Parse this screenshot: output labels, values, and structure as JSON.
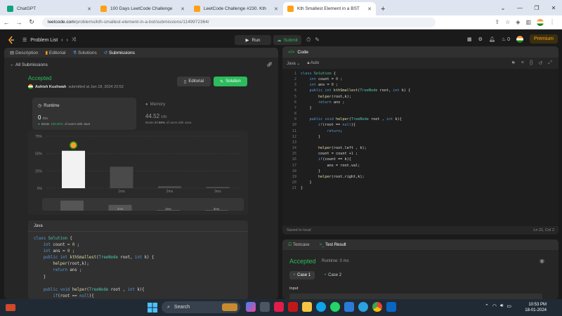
{
  "browser": {
    "tabs": [
      {
        "title": "ChatGPT",
        "color": "#10a37f"
      },
      {
        "title": "100 Days LeetCode Challenge",
        "color": "#ffa116"
      },
      {
        "title": "LeetCode Challenge #230. Kth",
        "color": "#ffa116"
      },
      {
        "title": "Kth Smallest Element in a BST",
        "color": "#ffa116"
      }
    ],
    "url_host": "leetcode.com",
    "url_path": "/problems/kth-smallest-element-in-a-bst/submissions/1149972364/"
  },
  "lc_header": {
    "problem_list": "Problem List",
    "run": "Run",
    "submit": "Submit",
    "streak": "0",
    "premium": "Premium"
  },
  "left_panel": {
    "tabs": [
      "Description",
      "Editorial",
      "Solutions",
      "Submissions"
    ],
    "all_submissions": "All Submissions",
    "status": "Accepted",
    "author": "Ashish Kushwah",
    "submitted": "submitted at Jan 18, 2024 22:52",
    "editorial_btn": "Editorial",
    "solution_btn": "Solution",
    "runtime": {
      "label": "Runtime",
      "value": "0",
      "unit": "ms",
      "beats_prefix": "Beats",
      "beats": "100.00%",
      "beats_suffix": "of users with Java"
    },
    "memory": {
      "label": "Memory",
      "value": "44.52",
      "unit": "MB",
      "beats_prefix": "Beats",
      "beats": "27.66%",
      "beats_suffix": "of users with Java"
    },
    "code_lang": "Java"
  },
  "chart_data": {
    "type": "bar",
    "yticks": [
      "75%",
      "50%",
      "25%",
      "0%"
    ],
    "ylim": [
      0,
      75
    ],
    "categories": [
      "",
      "1ms",
      "2ms",
      "3ms"
    ],
    "values": [
      54,
      31,
      3,
      2
    ],
    "highlight_index": 0,
    "overview_labels": [
      "",
      "1ms",
      "2ms",
      "3ms"
    ]
  },
  "submitted_code": [
    "class Solution {",
    "    int count = 0 ;",
    "    int ans = 0 ;",
    "    public int kthSmallest(TreeNode root, int k) {",
    "        helper(root,k);",
    "        return ans ;",
    "    }",
    "",
    "    public void helper(TreeNode root , int k){",
    "        if(root == null){"
  ],
  "editor": {
    "title": "Code",
    "lang": "Java",
    "mode": "Auto",
    "lines": [
      "class Solution {",
      "    int count = 0 ;",
      "    int ans = 0 ;",
      "    public int kthSmallest(TreeNode root, int k) {",
      "        helper(root,k);",
      "        return ans ;",
      "    }",
      "",
      "    public void helper(TreeNode root , int k){",
      "        if(root == null){",
      "            return;",
      "        }",
      "",
      "        helper(root.left , k);",
      "        count = count +1 ;",
      "        if(count == k){",
      "            ans = root.val;",
      "        }",
      "        helper(root.right,k);",
      "    }",
      "}"
    ],
    "saved": "Saved to local",
    "position": "Ln 21, Col 2"
  },
  "testcase": {
    "tab1": "Testcase",
    "tab2": "Test Result",
    "status": "Accepted",
    "runtime": "Runtime: 0 ms",
    "case1": "Case 1",
    "case2": "Case 2",
    "input_label": "Input"
  },
  "taskbar": {
    "search": "Search",
    "time": "10:53 PM",
    "date": "18-01-2024",
    "lang": "ENG IN"
  }
}
